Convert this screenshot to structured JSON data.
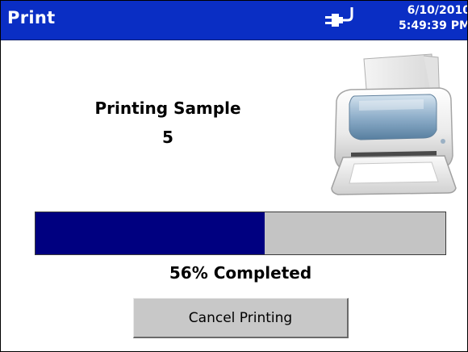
{
  "window": {
    "title": "Print",
    "date": "6/10/2010",
    "time": "5:49:39 PM",
    "connection_icon": "power-plug-icon",
    "title_bar_color": "#0a2ec4"
  },
  "status": {
    "label": "Printing Sample",
    "sample_number": "5",
    "printer_icon": "printer-icon"
  },
  "progress": {
    "percent": 56,
    "text": "56% Completed",
    "fill_color": "#000080",
    "track_color": "#c4c4c4"
  },
  "actions": {
    "cancel_label": "Cancel Printing"
  }
}
